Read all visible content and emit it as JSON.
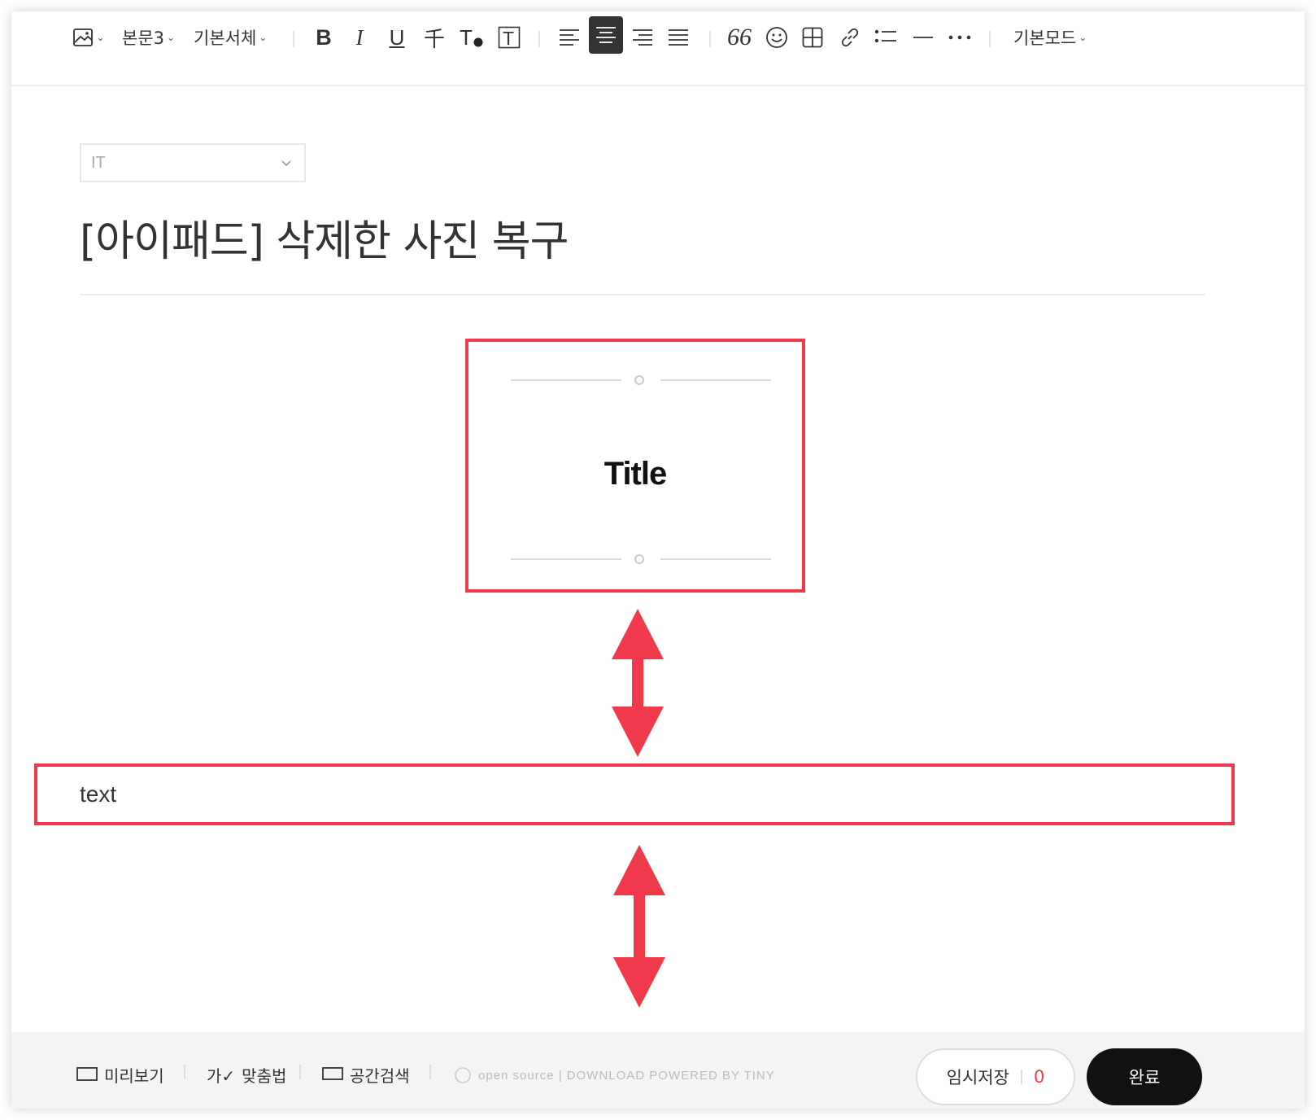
{
  "toolbar": {
    "image_icon": "image-icon",
    "paragraph_style": "본문3",
    "font_family": "기본서체",
    "mode": "기본모드",
    "active_align": "center"
  },
  "editor": {
    "category": "IT",
    "title": "[아이패드] 삭제한 사진 복구",
    "title_block_text": "Title",
    "paragraph_text": "text"
  },
  "bottom": {
    "preview": "미리보기",
    "spellcheck": "맞춤법",
    "spacing": "공간검색",
    "powered": "open source | DOWNLOAD    POWERED BY TINY",
    "save_label": "임시저장",
    "save_count": "0",
    "done_label": "완료"
  },
  "colors": {
    "highlight": "#f0394b",
    "active_button": "#333333"
  }
}
